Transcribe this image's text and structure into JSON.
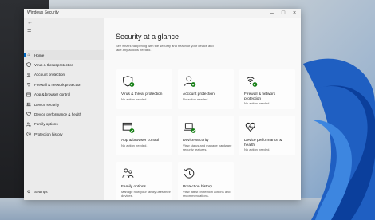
{
  "window": {
    "title": "Windows Security"
  },
  "sidebar": {
    "items": [
      {
        "label": "Home",
        "icon": "home-icon"
      },
      {
        "label": "Virus & threat protection",
        "icon": "shield-icon"
      },
      {
        "label": "Account protection",
        "icon": "person-icon"
      },
      {
        "label": "Firewall & network protection",
        "icon": "wifi-icon"
      },
      {
        "label": "App & browser control",
        "icon": "browser-icon"
      },
      {
        "label": "Device security",
        "icon": "laptop-icon"
      },
      {
        "label": "Device performance & health",
        "icon": "heart-icon"
      },
      {
        "label": "Family options",
        "icon": "family-icon"
      },
      {
        "label": "Protection history",
        "icon": "history-icon"
      }
    ],
    "settings_label": "Settings"
  },
  "main": {
    "heading": "Security at a glance",
    "subtext": "See what's happening with the security and health of your device and take any actions needed.",
    "cards": [
      {
        "title": "Virus & threat protection",
        "status": "No action needed.",
        "icon": "shield-icon"
      },
      {
        "title": "Account protection",
        "status": "No action needed.",
        "icon": "person-icon"
      },
      {
        "title": "Firewall & network protection",
        "status": "No action needed.",
        "icon": "wifi-icon"
      },
      {
        "title": "App & browser control",
        "status": "No action needed.",
        "icon": "browser-icon"
      },
      {
        "title": "Device security",
        "status": "View status and manage hardware security features.",
        "icon": "laptop-icon"
      },
      {
        "title": "Device performance & health",
        "status": "No action needed.",
        "icon": "heart-icon"
      },
      {
        "title": "Family options",
        "status": "Manage how your family uses their devices.",
        "icon": "family-icon"
      },
      {
        "title": "Protection history",
        "status": "View latest protection actions and recommendations.",
        "icon": "history-icon"
      }
    ]
  },
  "colors": {
    "accent": "#0067c0",
    "ok_green": "#107c10"
  }
}
